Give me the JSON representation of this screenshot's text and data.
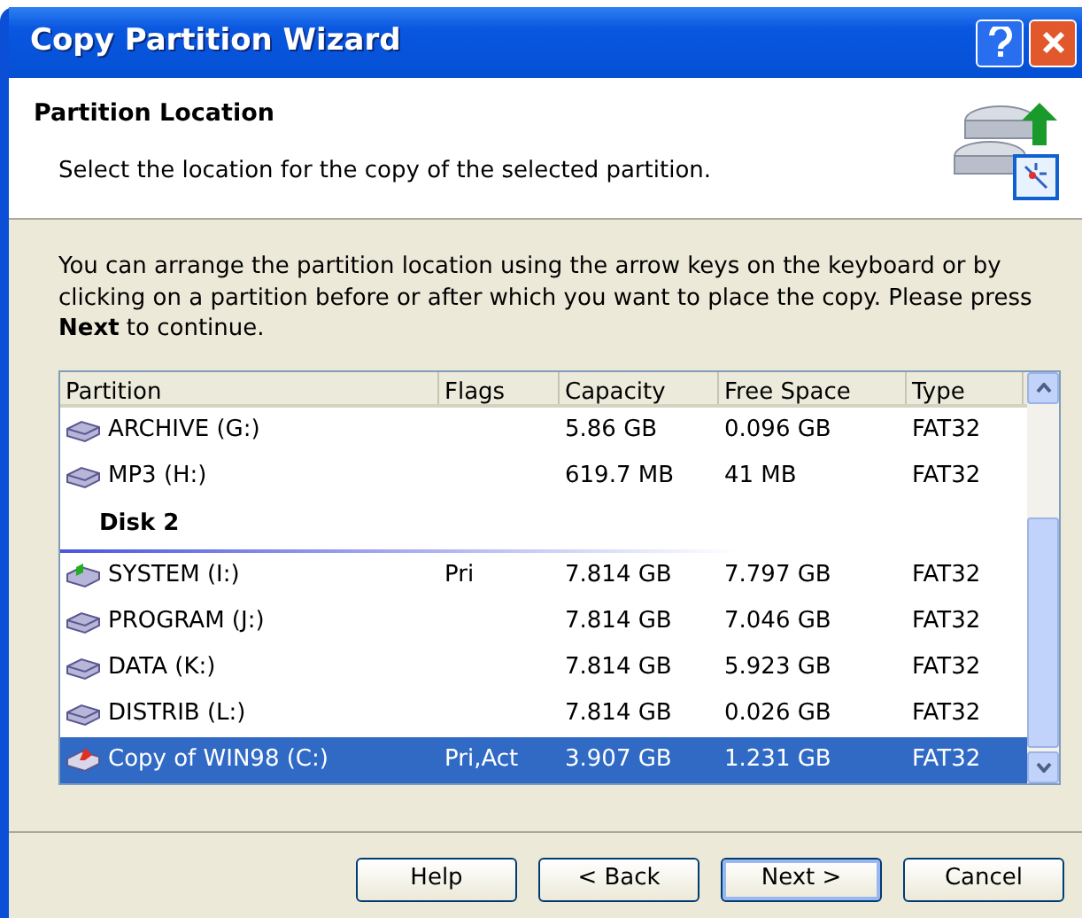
{
  "window": {
    "title": "Copy Partition Wizard"
  },
  "header": {
    "title": "Partition Location",
    "subtitle": "Select the location for the copy of the selected partition."
  },
  "instructions": "You can arrange the partition location using the arrow keys on the keyboard or by clicking on a partition before or after which you want to place the copy. Please press **Next** to continue.",
  "table": {
    "columns": [
      "Partition",
      "Flags",
      "Capacity",
      "Free Space",
      "Type"
    ],
    "rows": [
      {
        "kind": "drive",
        "selected": false,
        "cells": [
          "ARCHIVE (G:)",
          "",
          "5.86 GB",
          "0.096 GB",
          "FAT32"
        ]
      },
      {
        "kind": "drive",
        "selected": false,
        "cells": [
          "MP3 (H:)",
          "",
          "619.7 MB",
          "41 MB",
          "FAT32"
        ]
      },
      {
        "kind": "disk",
        "label": "Disk 2"
      },
      {
        "kind": "system-drive",
        "selected": false,
        "cells": [
          "SYSTEM (I:)",
          "Pri",
          "7.814 GB",
          "7.797 GB",
          "FAT32"
        ]
      },
      {
        "kind": "drive",
        "selected": false,
        "cells": [
          "PROGRAM (J:)",
          "",
          "7.814 GB",
          "7.046 GB",
          "FAT32"
        ]
      },
      {
        "kind": "drive",
        "selected": false,
        "cells": [
          "DATA (K:)",
          "",
          "7.814 GB",
          "5.923 GB",
          "FAT32"
        ]
      },
      {
        "kind": "drive",
        "selected": false,
        "cells": [
          "DISTRIB (L:)",
          "",
          "7.814 GB",
          "0.026 GB",
          "FAT32"
        ]
      },
      {
        "kind": "copy-drive",
        "selected": true,
        "cells": [
          "Copy of WIN98 (C:)",
          "Pri,Act",
          "3.907 GB",
          "1.231 GB",
          "FAT32"
        ]
      }
    ]
  },
  "buttons": [
    {
      "label": "Help",
      "default": false
    },
    {
      "label": "< Back",
      "default": false
    },
    {
      "label": "Next >",
      "default": true
    },
    {
      "label": "Cancel",
      "default": false
    }
  ]
}
